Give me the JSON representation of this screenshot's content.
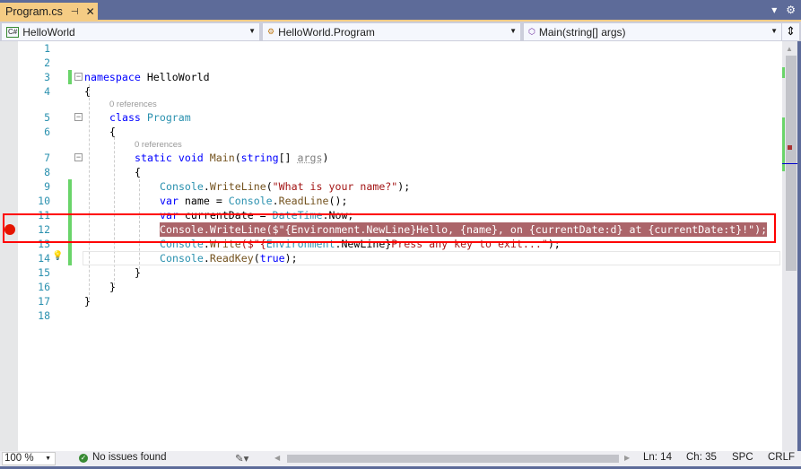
{
  "tab": {
    "title": "Program.cs",
    "pin_icon": "pin-icon",
    "close_icon": "close-icon"
  },
  "navbar": {
    "project": "HelloWorld",
    "type": "HelloWorld.Program",
    "member": "Main(string[] args)"
  },
  "colors": {
    "breakpoint": "#e51400",
    "selection": "#ab6469",
    "change_bar": "#6ad46a",
    "highlight_box": "#ff0000",
    "tab_active": "#f5cc84"
  },
  "lines": [
    {
      "n": "1",
      "indent": 0,
      "tokens": []
    },
    {
      "n": "2",
      "indent": 0,
      "tokens": []
    },
    {
      "n": "3",
      "indent": 0,
      "tokens": [
        {
          "t": "namespace ",
          "c": "kw"
        },
        {
          "t": "HelloWorld",
          "c": "pl"
        }
      ]
    },
    {
      "n": "4",
      "indent": 0,
      "tokens": [
        {
          "t": "{",
          "c": "pl"
        }
      ]
    },
    {
      "lens": "0 references",
      "indent": 1
    },
    {
      "n": "5",
      "indent": 1,
      "tokens": [
        {
          "t": "class ",
          "c": "kw"
        },
        {
          "t": "Program",
          "c": "ty"
        }
      ]
    },
    {
      "n": "6",
      "indent": 1,
      "tokens": [
        {
          "t": "{",
          "c": "pl"
        }
      ]
    },
    {
      "lens": "0 references",
      "indent": 2
    },
    {
      "n": "7",
      "indent": 2,
      "tokens": [
        {
          "t": "static void ",
          "c": "kw"
        },
        {
          "t": "Main",
          "c": "me"
        },
        {
          "t": "(",
          "c": "pl"
        },
        {
          "t": "string",
          "c": "kw"
        },
        {
          "t": "[] ",
          "c": "pl"
        },
        {
          "t": "args",
          "c": "pa"
        },
        {
          "t": ")",
          "c": "pl"
        }
      ]
    },
    {
      "n": "8",
      "indent": 2,
      "tokens": [
        {
          "t": "{",
          "c": "pl"
        }
      ]
    },
    {
      "n": "9",
      "indent": 3,
      "tokens": [
        {
          "t": "Console",
          "c": "ty"
        },
        {
          "t": ".",
          "c": "pl"
        },
        {
          "t": "WriteLine",
          "c": "me"
        },
        {
          "t": "(",
          "c": "pl"
        },
        {
          "t": "\"What is your name?\"",
          "c": "st"
        },
        {
          "t": ");",
          "c": "pl"
        }
      ]
    },
    {
      "n": "10",
      "indent": 3,
      "tokens": [
        {
          "t": "var ",
          "c": "kw"
        },
        {
          "t": "name = ",
          "c": "pl"
        },
        {
          "t": "Console",
          "c": "ty"
        },
        {
          "t": ".",
          "c": "pl"
        },
        {
          "t": "ReadLine",
          "c": "me"
        },
        {
          "t": "();",
          "c": "pl"
        }
      ]
    },
    {
      "n": "11",
      "indent": 3,
      "tokens": [
        {
          "t": "var ",
          "c": "kw"
        },
        {
          "t": "currentDate = ",
          "c": "pl"
        },
        {
          "t": "DateTime",
          "c": "ty"
        },
        {
          "t": ".Now;",
          "c": "pl"
        }
      ]
    },
    {
      "n": "12",
      "indent": 3,
      "selected": true,
      "tokens": [
        {
          "t": "Console.WriteLine($\"{Environment.NewLine}Hello, {name}, on {currentDate:d} at {currentDate:t}!\");",
          "c": "pl"
        }
      ]
    },
    {
      "n": "13",
      "indent": 3,
      "tokens": [
        {
          "t": "Console",
          "c": "ty"
        },
        {
          "t": ".",
          "c": "pl"
        },
        {
          "t": "Write",
          "c": "me"
        },
        {
          "t": "($\"{",
          "c": "st"
        },
        {
          "t": "Environment",
          "c": "ty"
        },
        {
          "t": ".NewLine}",
          "c": "pl"
        },
        {
          "t": "Press any key to exit...\"",
          "c": "st"
        },
        {
          "t": ");",
          "c": "pl"
        }
      ]
    },
    {
      "n": "14",
      "indent": 3,
      "tokens": [
        {
          "t": "Console",
          "c": "ty"
        },
        {
          "t": ".",
          "c": "pl"
        },
        {
          "t": "ReadKey",
          "c": "me"
        },
        {
          "t": "(",
          "c": "pl"
        },
        {
          "t": "true",
          "c": "kw"
        },
        {
          "t": ");",
          "c": "pl"
        }
      ]
    },
    {
      "n": "15",
      "indent": 2,
      "tokens": [
        {
          "t": "}",
          "c": "pl"
        }
      ]
    },
    {
      "n": "16",
      "indent": 1,
      "tokens": [
        {
          "t": "}",
          "c": "pl"
        }
      ]
    },
    {
      "n": "17",
      "indent": 0,
      "tokens": [
        {
          "t": "}",
          "c": "pl"
        }
      ]
    },
    {
      "n": "18",
      "indent": 0,
      "tokens": []
    }
  ],
  "status": {
    "zoom": "100 %",
    "issues": "No issues found",
    "ln": "Ln: 14",
    "ch": "Ch: 35",
    "spc": "SPC",
    "eol": "CRLF"
  }
}
